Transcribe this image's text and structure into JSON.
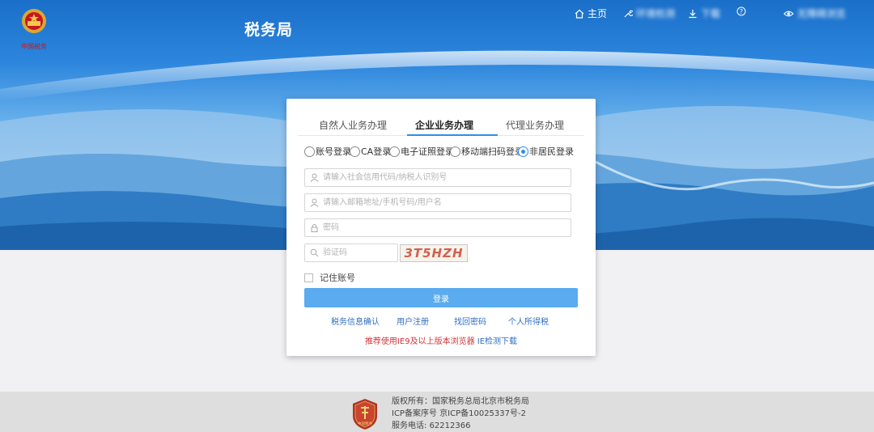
{
  "header": {
    "site_title": "税务局",
    "emblem_caption": "中国税务",
    "nav": {
      "home": "主页",
      "env_check": "环境检测",
      "download": "下载",
      "help_icon": "question-icon",
      "accessibility": "无障碍浏览"
    }
  },
  "login": {
    "tabs": [
      "自然人业务办理",
      "企业业务办理",
      "代理业务办理"
    ],
    "active_tab": "企业业务办理",
    "modes": [
      "账号登录",
      "CA登录",
      "电子证照登录",
      "移动端扫码登录",
      "非居民登录"
    ],
    "selected_mode": "非居民登录",
    "fields": {
      "credit_code_placeholder": "请输入社会信用代码/纳税人识别号",
      "account_placeholder": "请输入邮箱地址/手机号码/用户名",
      "password_placeholder": "密码",
      "captcha_placeholder": "验证码"
    },
    "captcha_text": "3T5HZH",
    "remember_label": "记住账号",
    "submit_label": "登录",
    "links": [
      "税务信息确认",
      "用户注册",
      "找回密码",
      "个人所得税"
    ],
    "notice_warning": "推荐使用IE9及以上版本浏览器",
    "notice_link": "IE检测下载"
  },
  "footer": {
    "badge_text": "中国税务",
    "copyright": "版权所有：国家税务总局北京市税务局",
    "icp": "ICP备案序号 京ICP备10025337号-2",
    "phone": "服务电话: 62212366"
  },
  "colors": {
    "accent": "#2e8ee8",
    "login_button": "#5aabef",
    "link": "#2e6fc4",
    "warning": "#d0343a"
  }
}
